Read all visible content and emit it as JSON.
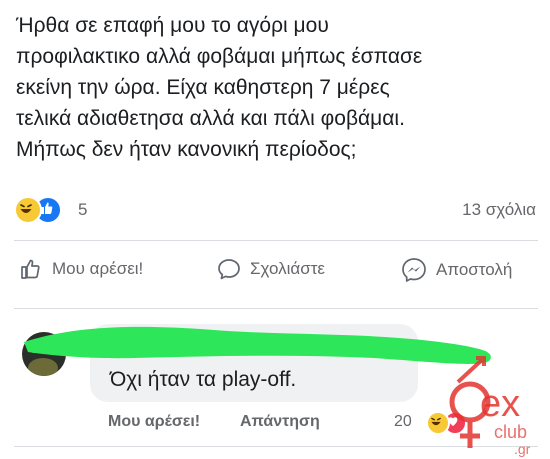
{
  "post": {
    "lines": [
      "Ήρθα σε επαφή μου το αγόρι μου",
      "προφιλακτικο αλλά φοβάμαι μήπως έσπασε",
      "εκείνη την ώρα. Είχα καθηστερη 7 μέρες",
      "τελικά αδιαθετησα αλλά και πάλι φοβάμαι.",
      "Μήπως δεν ήταν κανονική περίοδος;"
    ]
  },
  "reactions": {
    "icons": [
      "haha-reaction-icon",
      "like-reaction-icon"
    ],
    "count": "5",
    "comments_count": "13 σχόλια"
  },
  "actions": {
    "like_label": "Μου αρέσει!",
    "comment_label": "Σχολιάστε",
    "share_label": "Αποστολή"
  },
  "comment": {
    "text": "Όχι ήταν τα play-off.",
    "like_label": "Μου αρέσει!",
    "reply_label": "Απάντηση",
    "reaction_count": "20",
    "reaction_icons": [
      "haha-reaction-icon",
      "love-reaction-icon"
    ]
  },
  "colors": {
    "scribble": "#2ee65a",
    "watermark": "#e3342f",
    "text": "#1c1e21",
    "muted": "#65676b"
  },
  "watermark": {
    "main": "ex",
    "sub": "club",
    "tld": ".gr"
  }
}
